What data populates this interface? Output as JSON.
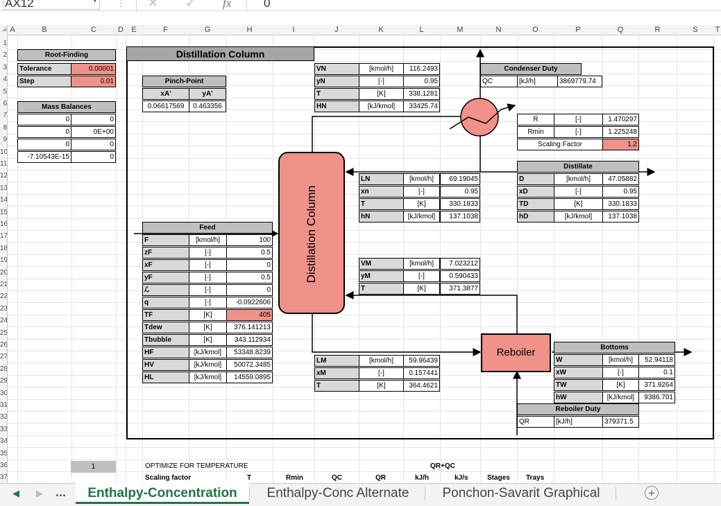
{
  "formula_bar": {
    "name_box": "AX12",
    "formula": "0",
    "fx_label": "fx"
  },
  "columns": [
    "A",
    "B",
    "C",
    "D",
    "E",
    "F",
    "G",
    "H",
    "I",
    "J",
    "K",
    "L",
    "M",
    "N",
    "O",
    "P",
    "Q",
    "R",
    "S",
    "T"
  ],
  "rows": [
    "1",
    "2",
    "3",
    "4",
    "5",
    "6",
    "7",
    "8",
    "9",
    "10",
    "11",
    "12",
    "13",
    "14",
    "15",
    "16",
    "17",
    "18",
    "19",
    "20",
    "21",
    "22",
    "23",
    "24",
    "25",
    "26",
    "27",
    "28",
    "29",
    "30",
    "31",
    "32",
    "33",
    "34",
    "35",
    "36",
    "37"
  ],
  "root_finding": {
    "title": "Root-Finding",
    "tolerance_label": "Tolerance",
    "tolerance": "0.00001",
    "step_label": "Step",
    "step": "0.01"
  },
  "mass_balances": {
    "title": "Mass Balances",
    "rows": [
      [
        "0",
        "0"
      ],
      [
        "0",
        "0E+00"
      ],
      [
        "0",
        "0"
      ],
      [
        "-7.10543E-15",
        "0"
      ]
    ]
  },
  "pinch": {
    "title": "Pinch-Point",
    "xa_label": "xA'",
    "ya_label": "yA'",
    "xa": "0.06617569",
    "ya": "0.463356"
  },
  "column_title": "Distillation Column",
  "column_body": "Distillation Column",
  "top_vapor": [
    [
      "VN",
      "[kmol/h]",
      "116.2493"
    ],
    [
      "yN",
      "[-]",
      "0.95"
    ],
    [
      "T",
      "[K]",
      "338.1281"
    ],
    [
      "HN",
      "[kJ/kmol]",
      "33425.74"
    ]
  ],
  "condenser": {
    "title": "Condenser Duty",
    "label": "QC",
    "unit": "[kJ/h]",
    "value": "3869779.74"
  },
  "reflux": [
    [
      "R",
      "[-]",
      "1.470297"
    ],
    [
      "Rmin",
      "[-]",
      "1.225248"
    ],
    [
      "Scaling Factor",
      "",
      "1.2"
    ]
  ],
  "distillate": {
    "title": "Distillate",
    "rows": [
      [
        "D",
        "[kmol/h]",
        "47.05882"
      ],
      [
        "xD",
        "[-]",
        "0.95"
      ],
      [
        "TD",
        "[K]",
        "330.1833"
      ],
      [
        "hD",
        "[kJ/kmol]",
        "137.1038"
      ]
    ]
  },
  "reflux_liquid": [
    [
      "LN",
      "[kmol/h]",
      "69.19045"
    ],
    [
      "xn",
      "[-]",
      "0.95"
    ],
    [
      "T",
      "[K]",
      "330.1833"
    ],
    [
      "hN",
      "[kJ/kmol]",
      "137.1038"
    ]
  ],
  "feed": {
    "title": "Feed",
    "rows": [
      [
        "F",
        "[kmol/h]",
        "100"
      ],
      [
        "zF",
        "[-]",
        "0.5"
      ],
      [
        "xF",
        "[-]",
        "0"
      ],
      [
        "yF",
        "[-]",
        "0.5"
      ],
      [
        "ℒ",
        "[-]",
        "0"
      ],
      [
        "q",
        "[-]",
        "-0.0922606"
      ],
      [
        "TF",
        "[K]",
        "405"
      ],
      [
        "Tdew",
        "[K]",
        "376.141213"
      ],
      [
        "Tbubble",
        "[K]",
        "343.112934"
      ],
      [
        "HF",
        "[kJ/kmol]",
        "53348.8239"
      ],
      [
        "HV",
        "[kJ/kmol]",
        "50072.3485"
      ],
      [
        "HL",
        "[kJ/kmol]",
        "14559.0895"
      ]
    ]
  },
  "boilup": [
    [
      "VM",
      "[kmol/h]",
      "7.023212"
    ],
    [
      "yM",
      "[-]",
      "0.590433"
    ],
    [
      "T",
      "[K]",
      "371.3877"
    ]
  ],
  "bottom_liquid": [
    [
      "LM",
      "[kmol/h]",
      "59.96439"
    ],
    [
      "xM",
      "[-]",
      "0.157441"
    ],
    [
      "T",
      "[K]",
      "364.4621"
    ]
  ],
  "reboiler_label": "Reboiler",
  "bottoms": {
    "title": "Bottoms",
    "rows": [
      [
        "W",
        "[kmol/h]",
        "52.94118"
      ],
      [
        "xW",
        "[-]",
        "0.1"
      ],
      [
        "TW",
        "[K]",
        "371.9264"
      ],
      [
        "hW",
        "[kJ/kmol]",
        "9386.701"
      ]
    ]
  },
  "reboiler_duty": {
    "title": "Reboiler Duty",
    "label": "QR",
    "unit": "[kJ/h]",
    "value": "379371.5"
  },
  "row36": {
    "b": "1",
    "optimize": "OPTIMIZE FOR TEMPERATURE",
    "qrqc": "QR+QC"
  },
  "row37": [
    "Scaling factor",
    "T",
    "Rmin",
    "QC",
    "QR",
    "kJ/h",
    "kJ/s",
    "Stages",
    "Trays"
  ],
  "tabs": [
    "Enthalpy-Concentration",
    "Enthalpy-Conc Alternate",
    "Ponchon-Savarit Graphical"
  ],
  "tab_more": "...",
  "accent": "#217346",
  "highlight": "#f0928a"
}
